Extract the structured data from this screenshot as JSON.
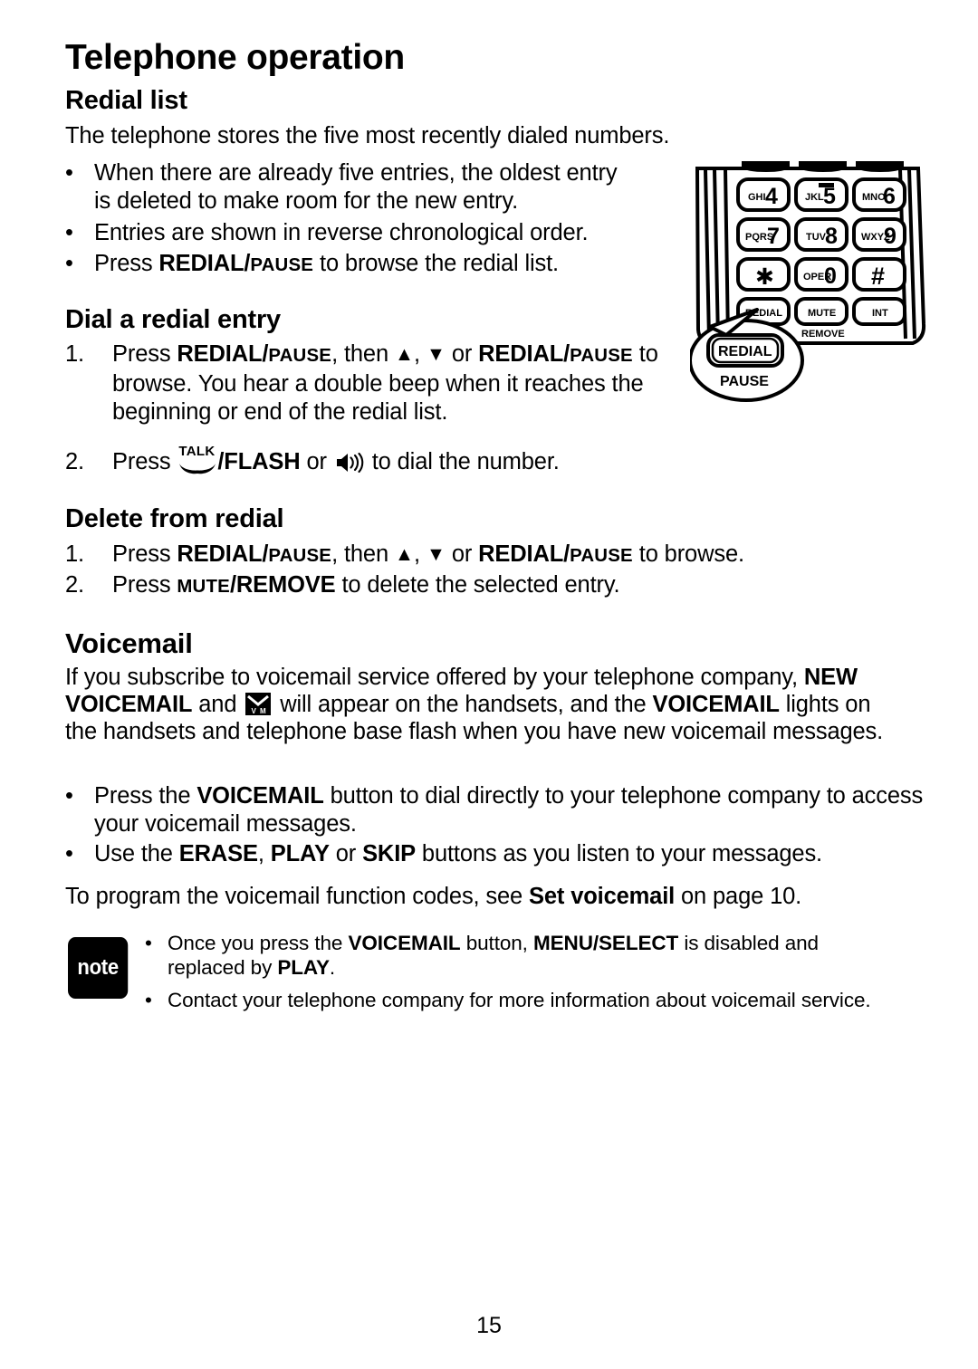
{
  "page": {
    "title": "Telephone operation",
    "number": "15"
  },
  "sections": {
    "redial_list": {
      "heading": "Redial list",
      "intro": "The telephone stores the five most recently dialed numbers.",
      "bullets": [
        "When there are already five entries, the oldest entry is deleted to make room for the new entry.",
        "Entries are shown in reverse chronological order."
      ],
      "bullet_press_prefix": "Press ",
      "bullet_press_key_main": "REDIAL",
      "bullet_press_key_sep": "/",
      "bullet_press_key_sub": "PAUSE",
      "bullet_press_suffix": " to browse the redial list."
    },
    "dial_a_redial_entry": {
      "heading": "Dial a redial entry",
      "step1": {
        "number": "1.",
        "p1": "Press ",
        "key1_main": "REDIAL",
        "key1_sep": "/",
        "key1_sub": "PAUSE",
        "p2": ", then ",
        "arrow_up": "▲",
        "p3": ", ",
        "arrow_down": "▼",
        "p4": " or ",
        "key2_main": "REDIAL",
        "key2_sep": "/",
        "key2_sub": "PAUSE",
        "p5": " to browse. You hear a double beep when it reaches the beginning or end of the redial list."
      },
      "step2": {
        "number": "2.",
        "p1": "Press ",
        "talk_label": "TALK",
        "flash_label": "/FLASH",
        "p2": " or ",
        "p3": " to dial the number."
      }
    },
    "delete_from_redial": {
      "heading": "Delete from redial",
      "step1": {
        "number": "1.",
        "p1": "Press ",
        "key1_main": "REDIAL",
        "key1_sep": "/",
        "key1_sub": "PAUSE",
        "p2": ", then ",
        "arrow_up": "▲",
        "p3": ", ",
        "arrow_down": "▼",
        "p4": " or ",
        "key2_main": "REDIAL",
        "key2_sep": "/",
        "key2_sub": "PAUSE",
        "p5": " to browse."
      },
      "step2": {
        "number": "2.",
        "p1": "Press ",
        "key_sub": "MUTE",
        "key_main": "/REMOVE",
        "p2": " to delete the selected entry."
      }
    },
    "voicemail": {
      "heading": "Voicemail",
      "intro": {
        "p1": "If you subscribe to voicemail service offered by your telephone company, ",
        "b1": "NEW VOICEMAIL",
        "p2": " and ",
        "p3": " will appear on the handsets, and the ",
        "b2": "VOICEMAIL",
        "p4": " lights on the handsets and telephone base flash when you have new voicemail messages."
      },
      "bullet1": {
        "p1": "Press the ",
        "b1": "VOICEMAIL",
        "p2": " button to dial directly to your telephone company to access your voicemail messages."
      },
      "bullet2": {
        "p1": "Use the ",
        "b1": "ERASE",
        "p2": ", ",
        "b2": "PLAY",
        "p3": " or ",
        "b3": "SKIP",
        "p4": " buttons as you listen to your messages."
      },
      "footer": {
        "p1": "To program the voicemail function codes, see ",
        "b1": "Set voicemail",
        "p2": " on page 10."
      }
    },
    "note": {
      "badge": "note",
      "items": [
        {
          "p1": "Once you press the ",
          "b1": "VOICEMAIL",
          "p2": " button, ",
          "b2": "MENU/SELECT",
          "p3": " is disabled and replaced by ",
          "b3": "PLAY",
          "p4": "."
        },
        {
          "p1": "Contact your telephone company for more information about voicemail service.",
          "b1": "",
          "p2": "",
          "b2": "",
          "p3": "",
          "b3": "",
          "p4": ""
        }
      ]
    }
  },
  "keypad_illustration": {
    "keys": [
      {
        "letters": "GHI",
        "digit": "4"
      },
      {
        "letters": "JKL",
        "digit": "5"
      },
      {
        "letters": "MNO",
        "digit": "6"
      },
      {
        "letters": "PQRS",
        "digit": "7"
      },
      {
        "letters": "TUV",
        "digit": "8"
      },
      {
        "letters": "WXYZ",
        "digit": "9"
      },
      {
        "letters": "",
        "digit": "✱"
      },
      {
        "letters": "OPER",
        "digit": "0"
      },
      {
        "letters": "",
        "digit": "#"
      }
    ],
    "function_keys": [
      {
        "top": "REDIAL",
        "bottom": "PAUSE"
      },
      {
        "top": "MUTE",
        "bottom": "REMOVE"
      },
      {
        "top": "INT",
        "bottom": ""
      }
    ],
    "callout": {
      "top": "REDIAL",
      "bottom": "PAUSE"
    }
  },
  "colors": {
    "ink": "#000000",
    "paper": "#ffffff"
  }
}
